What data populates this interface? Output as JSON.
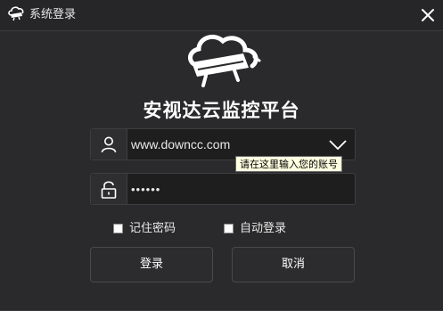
{
  "window": {
    "title": "系统登录"
  },
  "app": {
    "name": "安视达云监控平台"
  },
  "login": {
    "username_value": "www.downcc.com",
    "password_value": "******",
    "username_tooltip": "请在这里输入您的账号"
  },
  "options": {
    "remember_password_label": "记住密码",
    "remember_password_checked": false,
    "auto_login_label": "自动登录",
    "auto_login_checked": false
  },
  "buttons": {
    "login_label": "登录",
    "cancel_label": "取消"
  },
  "icons": {
    "title_icon": "cloud-camera-icon",
    "close": "close-icon",
    "logo": "cloud-camera-logo",
    "user": "user-icon",
    "lock": "lock-icon",
    "dropdown": "chevron-down-icon"
  },
  "colors": {
    "background": "#2a2a2c",
    "field_background": "#1e1e1f",
    "tooltip_background": "#ffffe1",
    "text": "#ffffff"
  }
}
